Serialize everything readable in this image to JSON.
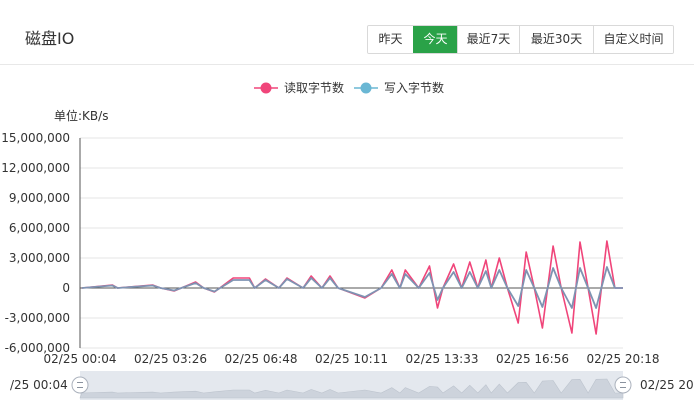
{
  "panel": {
    "title": "磁盘IO"
  },
  "time_range": {
    "options": [
      "昨天",
      "今天",
      "最近7天",
      "最近30天",
      "自定义时间"
    ],
    "selected": "今天"
  },
  "colors": {
    "accent": "#2aa248",
    "read_series": "#f0457a",
    "write_series": "#6ab7d4"
  },
  "chart_data": {
    "type": "line",
    "unit_label": "单位:KB/s",
    "ylim": [
      -6000000,
      15000000
    ],
    "y_ticks": [
      "15,000,000",
      "12,000,000",
      "9,000,000",
      "6,000,000",
      "3,000,000",
      "0",
      "-3,000,000",
      "-6,000,000"
    ],
    "x_ticks": [
      "02/25 00:04",
      "02/25 03:26",
      "02/25 06:48",
      "02/25 10:11",
      "02/25 13:33",
      "02/25 16:56",
      "02/25 20:18"
    ],
    "grid": true,
    "legend_position": "top-center",
    "x_time_hours": [
      0.07,
      1.2,
      1.4,
      2.7,
      3.0,
      3.5,
      4.3,
      4.6,
      5.0,
      5.7,
      6.1,
      6.3,
      6.5,
      6.9,
      7.4,
      7.7,
      8.3,
      8.6,
      9.0,
      9.3,
      9.6,
      10.6,
      11.2,
      11.6,
      11.9,
      12.1,
      12.6,
      13.0,
      13.3,
      13.5,
      13.9,
      14.2,
      14.5,
      14.8,
      15.1,
      15.3,
      15.6,
      15.9,
      16.3,
      16.6,
      16.9,
      17.2,
      17.6,
      17.9,
      18.3,
      18.6,
      18.9,
      19.2,
      19.6,
      19.9,
      20.2
    ],
    "series": [
      {
        "name": "读取字节数",
        "values": [
          0,
          300000,
          0,
          300000,
          0,
          -300000,
          600000,
          0,
          -400000,
          1000000,
          1000000,
          1000000,
          0,
          900000,
          0,
          1000000,
          0,
          1200000,
          0,
          1200000,
          0,
          -1000000,
          0,
          1800000,
          0,
          1800000,
          0,
          2200000,
          -2000000,
          0,
          2400000,
          0,
          2600000,
          0,
          2800000,
          0,
          3000000,
          0,
          -3500000,
          3600000,
          0,
          -4000000,
          4200000,
          0,
          -4500000,
          4600000,
          0,
          -4600000,
          4700000,
          0,
          0
        ]
      },
      {
        "name": "写入字节数",
        "values": [
          0,
          250000,
          0,
          250000,
          0,
          -250000,
          500000,
          0,
          -350000,
          800000,
          800000,
          800000,
          0,
          800000,
          0,
          900000,
          0,
          1000000,
          0,
          1000000,
          0,
          -900000,
          0,
          1400000,
          0,
          1400000,
          0,
          1500000,
          -1200000,
          0,
          1600000,
          0,
          1600000,
          0,
          1700000,
          0,
          1800000,
          0,
          -1800000,
          1800000,
          0,
          -1900000,
          2000000,
          0,
          -2000000,
          2000000,
          0,
          -2000000,
          2100000,
          0,
          0
        ]
      }
    ]
  },
  "zoom": {
    "start_label": "/25 00:04",
    "end_label": "02/25 20",
    "start_fraction": 0.0,
    "end_fraction": 1.0
  }
}
